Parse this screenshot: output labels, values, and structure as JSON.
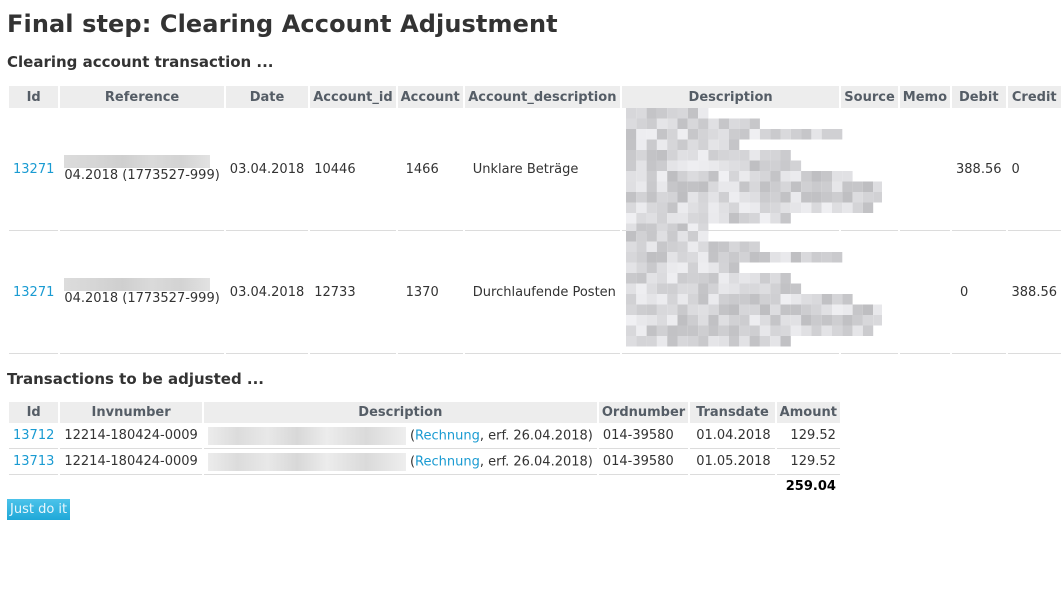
{
  "page": {
    "title": "Final step: Clearing Account Adjustment",
    "section1_title": "Clearing account transaction ...",
    "section2_title": "Transactions to be adjusted ..."
  },
  "clearing_table": {
    "headers": [
      "Id",
      "Reference",
      "Date",
      "Account_id",
      "Account",
      "Account_description",
      "Description",
      "Source",
      "Memo",
      "Debit",
      "Credit"
    ],
    "rows": [
      {
        "id": "13271",
        "reference_visible": "04.2018 (1773527-999)",
        "date": "03.04.2018",
        "account_id": "10446",
        "account": "1466",
        "account_description": "Unklare Beträge",
        "description": "[redacted]",
        "source": "",
        "memo": "",
        "debit": "388.56",
        "credit": "0"
      },
      {
        "id": "13271",
        "reference_visible": "04.2018 (1773527-999)",
        "date": "03.04.2018",
        "account_id": "12733",
        "account": "1370",
        "account_description": "Durchlaufende Posten",
        "description": "[redacted]",
        "source": "",
        "memo": "",
        "debit": "0",
        "credit": "388.56"
      }
    ]
  },
  "adjust_table": {
    "headers": [
      "Id",
      "Invnumber",
      "Description",
      "Ordnumber",
      "Transdate",
      "Amount"
    ],
    "rows": [
      {
        "id": "13712",
        "invnumber": "12214-180424-0009",
        "description_link": "Rechnung",
        "description_suffix": ", erf. 26.04.2018)",
        "ordnumber": "014-39580",
        "transdate": "01.04.2018",
        "amount": "129.52"
      },
      {
        "id": "13713",
        "invnumber": "12214-180424-0009",
        "description_link": "Rechnung",
        "description_suffix": ", erf. 26.04.2018)",
        "ordnumber": "014-39580",
        "transdate": "01.05.2018",
        "amount": "129.52"
      }
    ],
    "total": "259.04"
  },
  "actions": {
    "submit_label": "Just do it"
  },
  "colors": {
    "link": "#1a9bd2",
    "header_bg": "#ededed",
    "button_bg": "#1fa8d8"
  }
}
